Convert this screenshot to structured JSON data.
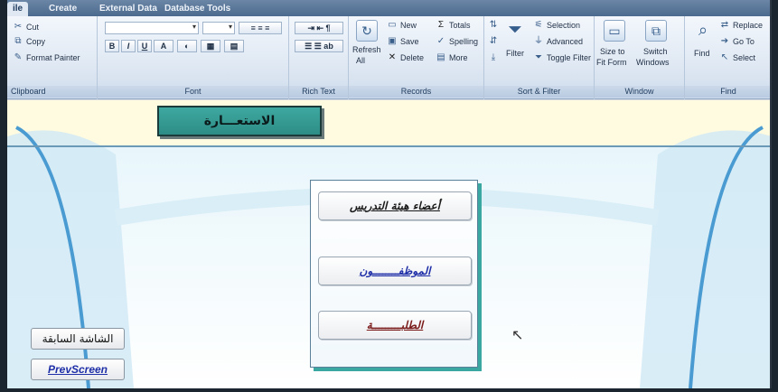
{
  "ribbon": {
    "tabs": [
      "ile",
      "Create",
      "External Data",
      "Database Tools"
    ],
    "clipboard": {
      "cut": "Cut",
      "copy": "Copy",
      "format_painter": "Format Painter",
      "label": "Clipboard"
    },
    "font": {
      "label": "Font",
      "bold": "B",
      "italic": "I",
      "underline": "U",
      "font_color": "A"
    },
    "rich_text": {
      "label": "Rich Text"
    },
    "records": {
      "refresh": "Refresh",
      "refresh_sub": "All",
      "new": "New",
      "save": "Save",
      "delete": "Delete",
      "totals": "Totals",
      "spelling": "Spelling",
      "more": "More",
      "label": "Records"
    },
    "sort_filter": {
      "filter": "Filter",
      "selection": "Selection",
      "advanced": "Advanced",
      "toggle_filter": "Toggle Filter",
      "label": "Sort & Filter"
    },
    "window": {
      "size_to": "Size to",
      "fit_form": "Fit Form",
      "switch": "Switch",
      "windows": "Windows",
      "label": "Window"
    },
    "find": {
      "find": "Find",
      "replace": "Replace",
      "goto": "Go To",
      "select": "Select",
      "label": "Find"
    }
  },
  "form": {
    "title": "الاستعـــارة",
    "buttons": [
      {
        "label": "أعضاء هيئة التدريس",
        "color": "#1a1a1a"
      },
      {
        "label": "الموظفــــــــون",
        "color": "#1f2fa8"
      },
      {
        "label": "الطلبـــــــــة",
        "color": "#7a1a1a"
      }
    ],
    "prev_screen_ar": "الشاشة السابقة",
    "prev_screen_en": "PrevScreen"
  },
  "colors": {
    "ribbon_bg": "#dfe8f3",
    "canvas_bg": "#fffbe0",
    "title_bg": "#3ea8a0",
    "link_blue": "#1f2fa8"
  }
}
